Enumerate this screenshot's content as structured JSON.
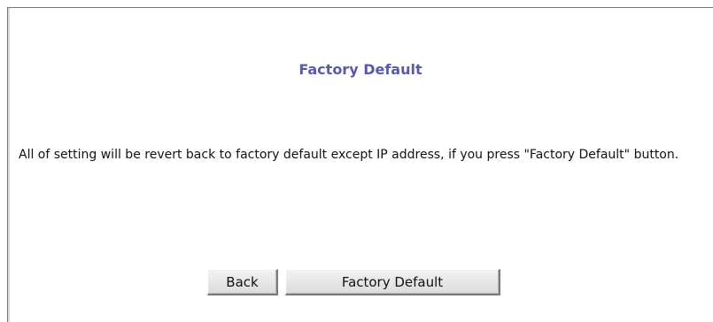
{
  "page": {
    "title": "Factory Default",
    "message": "All of setting will be revert back to factory default except IP address, if you press \"Factory Default\" button."
  },
  "buttons": {
    "back_label": "Back",
    "factory_default_label": "Factory Default"
  },
  "colors": {
    "title": "#5a5aa9",
    "frame_border": "#777777",
    "button_face": "#e6e6e6"
  }
}
